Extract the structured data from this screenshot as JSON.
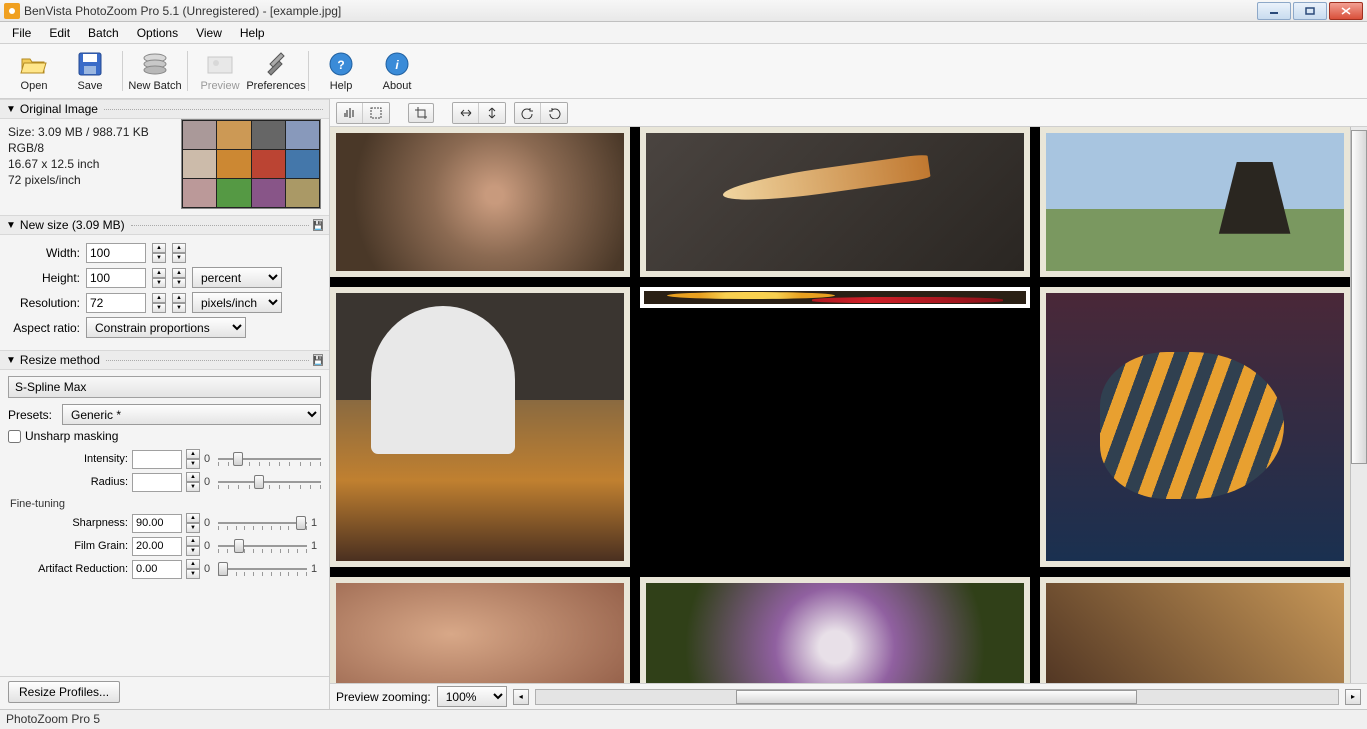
{
  "window": {
    "title": "BenVista PhotoZoom Pro 5.1 (Unregistered) - [example.jpg]"
  },
  "menu": [
    "File",
    "Edit",
    "Batch",
    "Options",
    "View",
    "Help"
  ],
  "toolbar": [
    {
      "id": "open",
      "label": "Open"
    },
    {
      "id": "save",
      "label": "Save"
    },
    {
      "id": "newbatch",
      "label": "New Batch"
    },
    {
      "id": "preview",
      "label": "Preview",
      "disabled": true
    },
    {
      "id": "preferences",
      "label": "Preferences"
    },
    {
      "id": "help",
      "label": "Help"
    },
    {
      "id": "about",
      "label": "About"
    }
  ],
  "original": {
    "header": "Original Image",
    "size_line": "Size: 3.09 MB / 988.71 KB",
    "mode": "RGB/8",
    "dims": "16.67 x 12.5 inch",
    "res": "72 pixels/inch"
  },
  "newsize": {
    "header": "New size (3.09 MB)",
    "width_label": "Width:",
    "width": "100",
    "height_label": "Height:",
    "height": "100",
    "unit": "percent",
    "res_label": "Resolution:",
    "res": "72",
    "res_unit": "pixels/inch",
    "aspect_label": "Aspect ratio:",
    "aspect": "Constrain proportions"
  },
  "resize": {
    "header": "Resize method",
    "method": "S-Spline Max",
    "presets_label": "Presets:",
    "preset": "Generic *",
    "unsharp_label": "Unsharp masking",
    "intensity_label": "Intensity:",
    "intensity": "",
    "radius_label": "Radius:",
    "radius": "",
    "intensity_min": "0",
    "radius_min": "0",
    "finetune_label": "Fine-tuning",
    "sharp_label": "Sharpness:",
    "sharp": "90.00",
    "sharp_min": "0",
    "sharp_max": "1",
    "grain_label": "Film Grain:",
    "grain": "20.00",
    "grain_min": "0",
    "grain_max": "1",
    "artifact_label": "Artifact Reduction:",
    "artifact": "0.00",
    "artifact_min": "0",
    "artifact_max": "1",
    "profiles_btn": "Resize Profiles..."
  },
  "preview": {
    "zoom_label": "Preview zooming:",
    "zoom": "100%"
  },
  "status": "PhotoZoom Pro 5"
}
